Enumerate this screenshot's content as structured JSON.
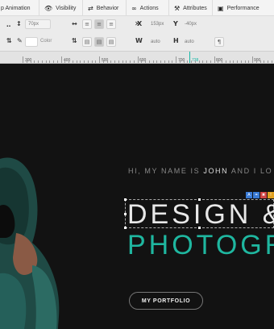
{
  "tabs": [
    {
      "label": "p Animation",
      "icon": "play-icon"
    },
    {
      "label": "Visibility",
      "icon": "eye-icon"
    },
    {
      "label": "Behavior",
      "icon": "arrows-icon"
    },
    {
      "label": "Actions",
      "icon": "link-icon"
    },
    {
      "label": "Attributes",
      "icon": "tools-icon"
    },
    {
      "label": "Performance",
      "icon": "image-icon"
    }
  ],
  "toolbar": {
    "line_height": "70px",
    "color_label": "Color",
    "x_label": "X",
    "x_value": "153px",
    "y_label": "Y",
    "y_value": "-40px",
    "w_label": "W",
    "w_value": "auto",
    "h_label": "H",
    "h_value": "auto"
  },
  "ruler": {
    "labels": [
      "300",
      "400",
      "500",
      "600",
      "700",
      "800",
      "900"
    ],
    "marker": "738"
  },
  "hero": {
    "intro_pre": "HI, MY NAME IS ",
    "intro_name": "JOHN",
    "intro_post": " AND I LO",
    "heading_line1": "DESIGN &",
    "heading_line2": "PHOTOGR",
    "button_label": "MY PORTFOLIO"
  },
  "colors": {
    "accent": "#1fb7a0",
    "background": "#121212"
  }
}
